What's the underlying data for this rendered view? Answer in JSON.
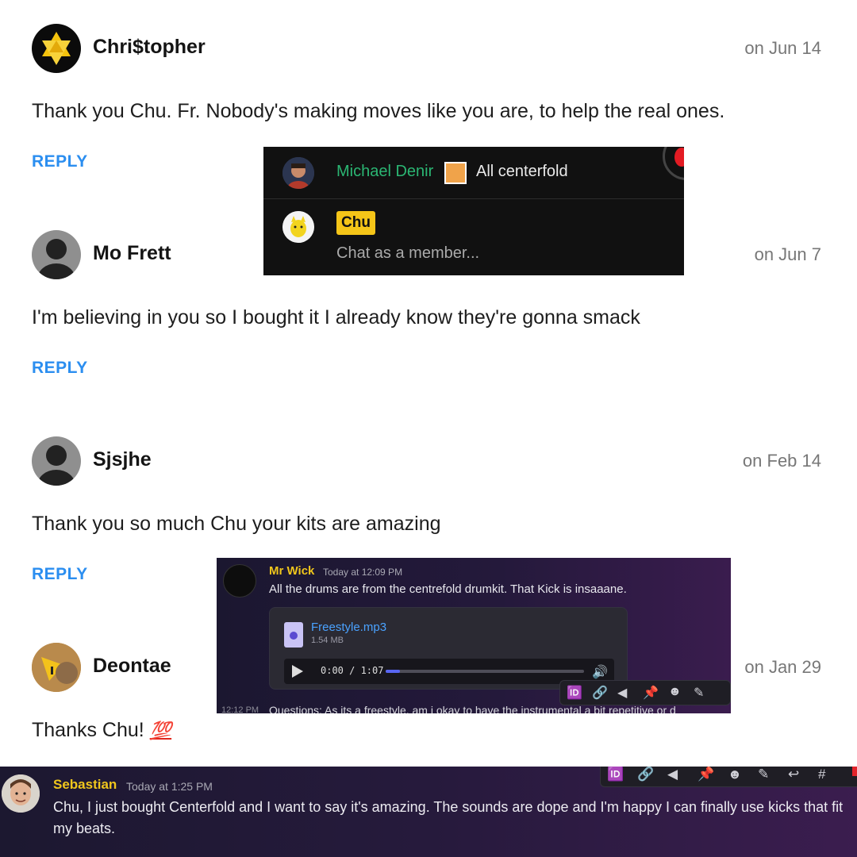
{
  "comments": [
    {
      "author": "Chri$topher",
      "date": "on Jun 14",
      "text": "Thank you Chu. Fr. Nobody's making moves like you are, to help the real ones.",
      "reply": "REPLY",
      "avatar": "hexagram-star-avatar"
    },
    {
      "author": "Mo Frett",
      "date": "on Jun 7",
      "text": "I'm believing in you so I bought it I already know they're gonna smack",
      "reply": "REPLY",
      "avatar": "default-silhouette-avatar"
    },
    {
      "author": "Sjsjhe",
      "date": "on Feb 14",
      "text": "Thank you so much Chu your kits are amazing",
      "reply": "REPLY",
      "avatar": "default-silhouette-avatar"
    },
    {
      "author": "Deontae",
      "date": "on Jan 29",
      "text": "Thanks Chu!",
      "emoji": "💯",
      "reply": "REPLY",
      "avatar": "photo-avatar"
    }
  ],
  "shot_live_chat": {
    "message_author": "Michael Denir",
    "message_text": "All centerfold",
    "member_badge": "Chu",
    "input_placeholder": "Chat as a member...",
    "colors": {
      "author": "#2bb673",
      "badge": "#f5c518"
    }
  },
  "shot_audio": {
    "author": "Mr Wick",
    "time": "Today at 12:09 PM",
    "message": "All the drums are from the centrefold drumkit. That Kick is insaaane.",
    "file_name": "Freestyle.mp3",
    "file_size": "1.54 MB",
    "player_time": "0:00 / 1:07",
    "progress": 0.07,
    "toolbar_icons": [
      "id-icon",
      "link-icon",
      "tag-icon",
      "pin-icon",
      "add-reaction-icon",
      "edit-icon"
    ],
    "next_time": "12:12 PM",
    "next_message": "Questions: As its a freestyle, am i okay to have the instrumental a bit repetitive or d"
  },
  "shot_message": {
    "author": "Sebastian",
    "time": "Today at 1:25 PM",
    "message": "Chu, I just bought Centerfold and I want to say it's amazing. The sounds are dope and I'm happy I can finally use kicks that fit my beats.",
    "toolbar_icons": [
      "id-icon",
      "link-icon",
      "tag-icon",
      "pin-icon",
      "add-reaction-icon",
      "edit-icon",
      "reply-icon",
      "thread-icon"
    ]
  }
}
